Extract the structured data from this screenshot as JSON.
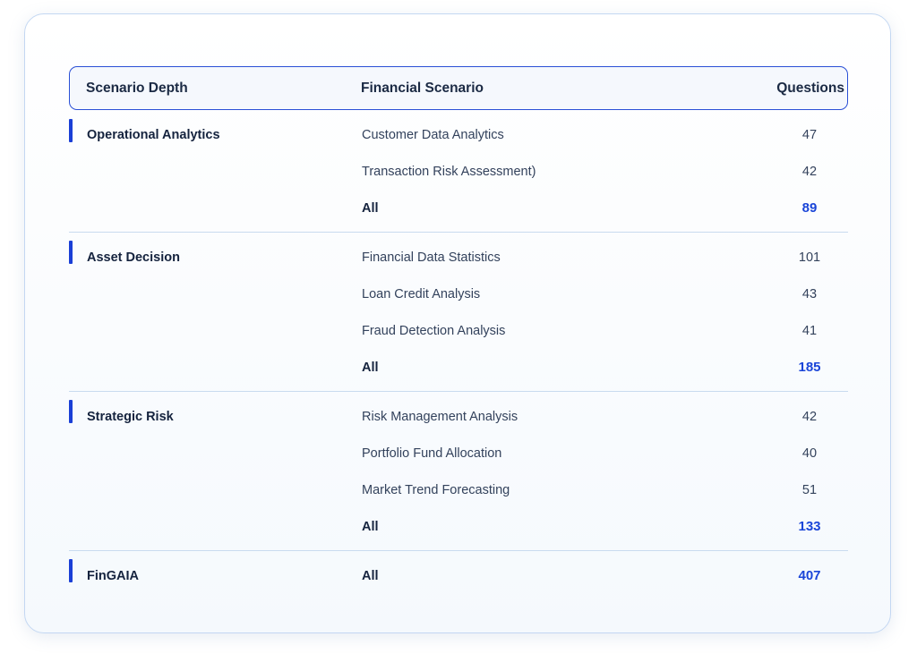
{
  "header": {
    "depth": "Scenario Depth",
    "scenario": "Financial Scenario",
    "questions": "Questions"
  },
  "groups": [
    {
      "depth": "Operational Analytics",
      "rows": [
        {
          "scenario": "Customer Data Analytics",
          "questions": "47"
        },
        {
          "scenario": "Transaction Risk Assessment)",
          "questions": "42"
        }
      ],
      "all_label": "All",
      "total": "89"
    },
    {
      "depth": "Asset Decision",
      "rows": [
        {
          "scenario": "Financial Data Statistics",
          "questions": "101"
        },
        {
          "scenario": "Loan Credit Analysis",
          "questions": "43"
        },
        {
          "scenario": "Fraud Detection Analysis",
          "questions": "41"
        }
      ],
      "all_label": "All",
      "total": "185"
    },
    {
      "depth": "Strategic Risk",
      "rows": [
        {
          "scenario": "Risk Management Analysis",
          "questions": "42"
        },
        {
          "scenario": "Portfolio Fund Allocation",
          "questions": "40"
        },
        {
          "scenario": "Market Trend Forecasting",
          "questions": "51"
        }
      ],
      "all_label": "All",
      "total": "133"
    },
    {
      "depth": "FinGAIA",
      "rows": [],
      "all_label": "All",
      "total": "407"
    }
  ],
  "colors": {
    "accent": "#1a3fd6",
    "total_text": "#1a45d8",
    "divider": "#c9dbef"
  }
}
